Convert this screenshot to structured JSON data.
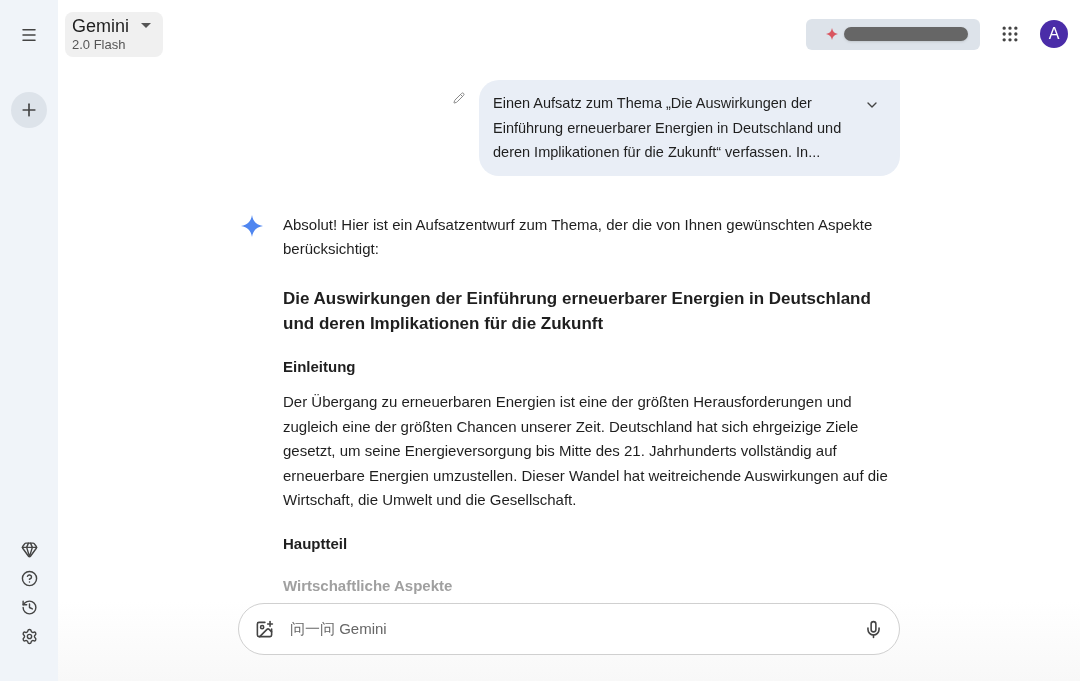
{
  "model_selector": {
    "name": "Gemini",
    "version": "2.0 Flash"
  },
  "avatar": {
    "initial": "A"
  },
  "user_message": {
    "text": "Einen Aufsatz zum Thema „Die Auswirkungen der Einführung erneuerbarer Energien in Deutschland und deren Implikationen für die Zukunft“ verfassen. In..."
  },
  "response": {
    "blocks": [
      {
        "kind": "paragraph",
        "text": "Absolut! Hier ist ein Aufsatzentwurf zum Thema, der die von Ihnen gewünschten Aspekte berücksichtigt:"
      },
      {
        "kind": "title",
        "text": "Die Auswirkungen der Einführung erneuerbarer Energien in Deutschland und deren Implikationen für die Zukunft"
      },
      {
        "kind": "heading",
        "text": "Einleitung"
      },
      {
        "kind": "paragraph",
        "text": "Der Übergang zu erneuerbaren Energien ist eine der größten Herausforderungen und zugleich eine der größten Chancen unserer Zeit. Deutschland hat sich ehrgeizige Ziele gesetzt, um seine Energieversorgung bis Mitte des 21. Jahrhunderts vollständig auf erneuerbare Energien umzustellen. Dieser Wandel hat weitreichende Auswirkungen auf die Wirtschaft, die Umwelt und die Gesellschaft."
      },
      {
        "kind": "heading",
        "text": "Hauptteil"
      },
      {
        "kind": "faded_heading",
        "text": "Wirtschaftliche Aspekte"
      }
    ]
  },
  "input": {
    "placeholder": "问一问 Gemini"
  }
}
